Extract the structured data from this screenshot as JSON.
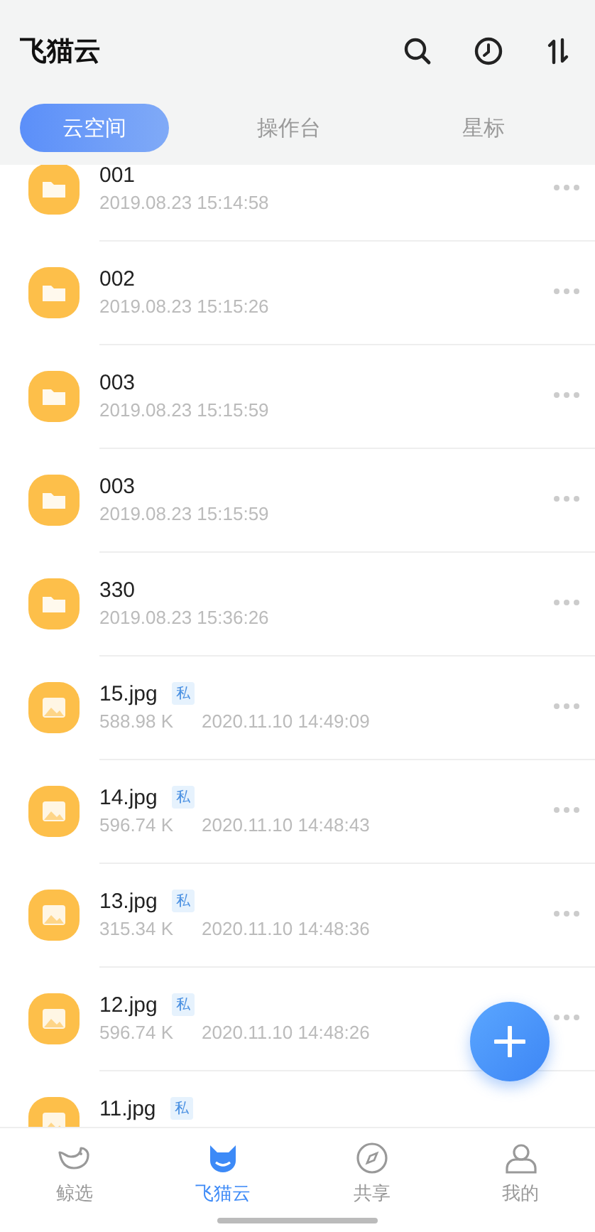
{
  "header": {
    "title": "飞猫云"
  },
  "tabs": [
    {
      "label": "云空间",
      "selected": true
    },
    {
      "label": "操作台",
      "selected": false
    },
    {
      "label": "星标",
      "selected": false
    }
  ],
  "files": [
    {
      "kind": "folder",
      "name": "001",
      "date": "2019.08.23 15:14:58"
    },
    {
      "kind": "folder",
      "name": "002",
      "date": "2019.08.23 15:15:26"
    },
    {
      "kind": "folder",
      "name": "003",
      "date": "2019.08.23 15:15:59"
    },
    {
      "kind": "folder",
      "name": "003",
      "date": "2019.08.23 15:15:59"
    },
    {
      "kind": "folder",
      "name": "330",
      "date": "2019.08.23 15:36:26"
    },
    {
      "kind": "image",
      "name": "15.jpg",
      "badge": "私",
      "size": "588.98 K",
      "date": "2020.11.10 14:49:09"
    },
    {
      "kind": "image",
      "name": "14.jpg",
      "badge": "私",
      "size": "596.74 K",
      "date": "2020.11.10 14:48:43"
    },
    {
      "kind": "image",
      "name": "13.jpg",
      "badge": "私",
      "size": "315.34 K",
      "date": "2020.11.10 14:48:36"
    },
    {
      "kind": "image",
      "name": "12.jpg",
      "badge": "私",
      "size": "596.74 K",
      "date": "2020.11.10 14:48:26"
    },
    {
      "kind": "image",
      "name": "11.jpg",
      "badge": "私"
    }
  ],
  "bottom_nav": [
    {
      "kind": "whale",
      "label": "鲸选",
      "selected": false
    },
    {
      "kind": "cat",
      "label": "飞猫云",
      "selected": true
    },
    {
      "kind": "compass",
      "label": "共享",
      "selected": false
    },
    {
      "kind": "person",
      "label": "我的",
      "selected": false
    }
  ]
}
